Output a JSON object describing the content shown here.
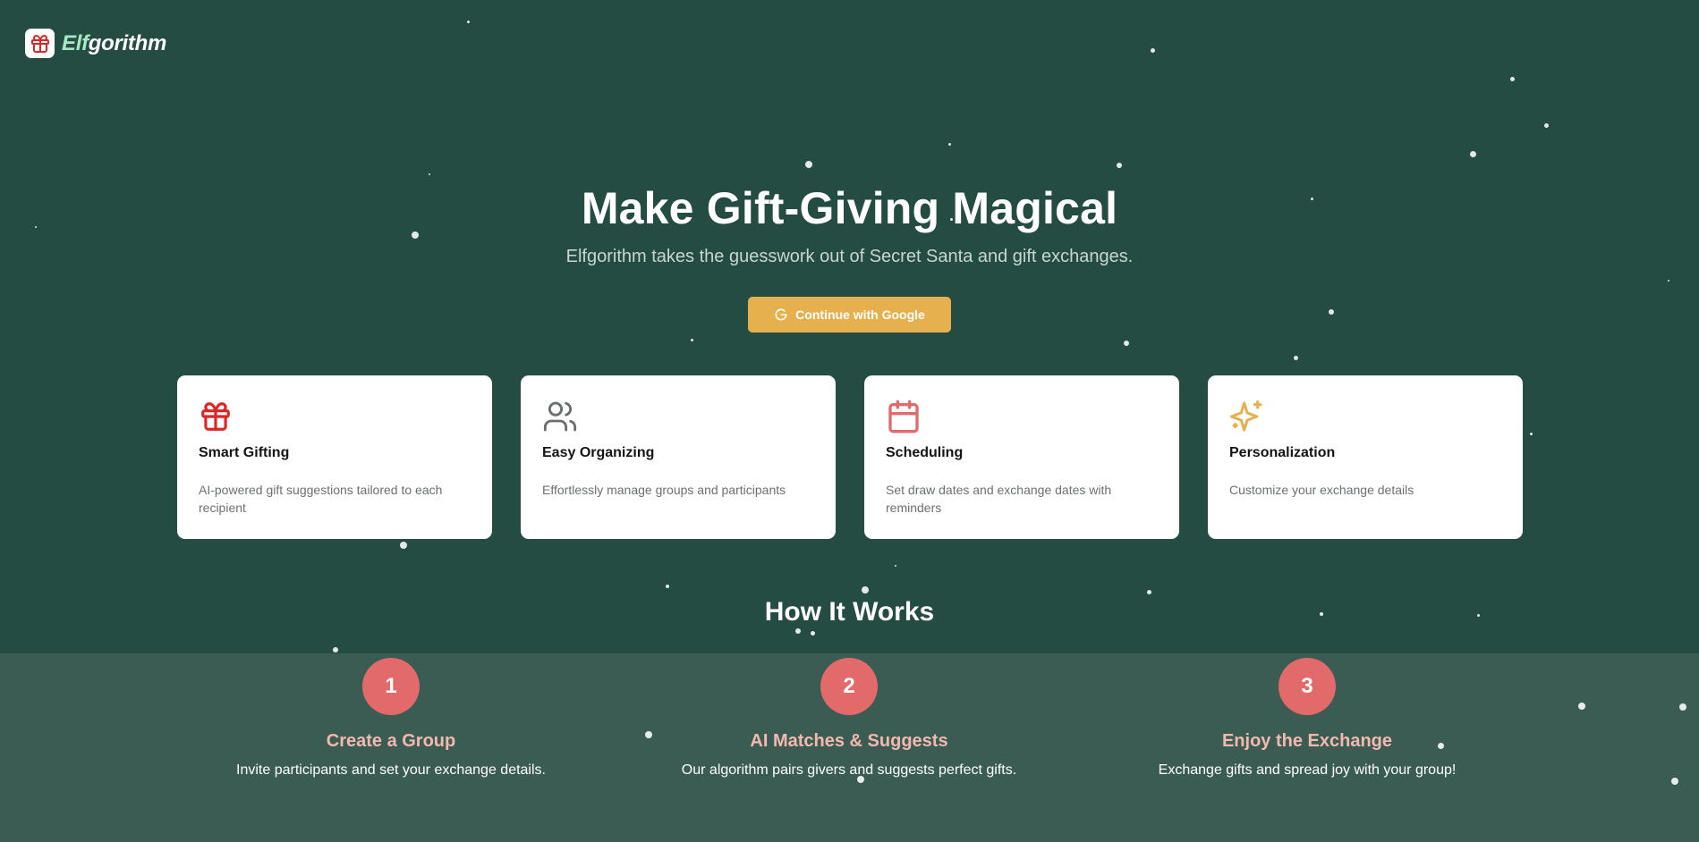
{
  "brand": {
    "name_prefix": "Elf",
    "name_suffix": "gorithm",
    "logo_icon": "gift-icon",
    "accent_color": "#a6e8c4"
  },
  "hero": {
    "title": "Make Gift-Giving Magical",
    "subtitle": "Elfgorithm takes the guesswork out of Secret Santa and gift exchanges.",
    "cta_label": "Continue with Google",
    "cta_icon": "google-icon",
    "cta_color": "#e7b04e"
  },
  "features": [
    {
      "icon": "gift-icon",
      "title": "Smart Gifting",
      "description": "AI-powered gift suggestions tailored to each recipient"
    },
    {
      "icon": "users-icon",
      "title": "Easy Organizing",
      "description": "Effortlessly manage groups and participants"
    },
    {
      "icon": "calendar-icon",
      "title": "Scheduling",
      "description": "Set draw dates and exchange dates with reminders"
    },
    {
      "icon": "sparkles-icon",
      "title": "Personalization",
      "description": "Customize your exchange details"
    }
  ],
  "how_it_works": {
    "title": "How It Works",
    "steps": [
      {
        "number": "1",
        "title": "Create a Group",
        "description": "Invite participants and set your exchange details."
      },
      {
        "number": "2",
        "title": "AI Matches & Suggests",
        "description": "Our algorithm pairs givers and suggests perfect gifts."
      },
      {
        "number": "3",
        "title": "Enjoy the Exchange",
        "description": "Exchange gifts and spread joy with your group!"
      }
    ]
  },
  "colors": {
    "background": "#244c43",
    "band": "#3a5c53",
    "step_circle": "#e26a6a",
    "step_title": "#f3b8b0",
    "gift_icon": "#dc2626",
    "users_icon": "#6b6f6c",
    "calendar_icon": "#e26a6a",
    "sparkles_icon": "#e7b04e"
  }
}
